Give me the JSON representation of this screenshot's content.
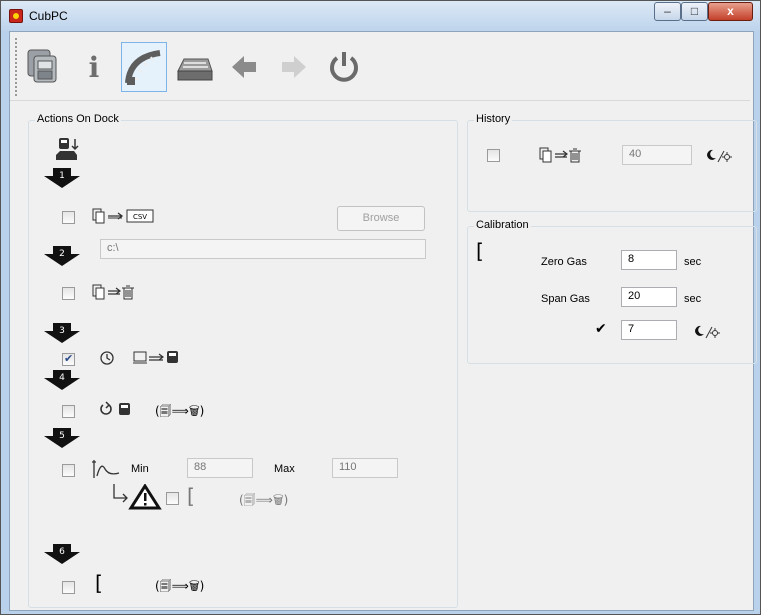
{
  "window": {
    "title": "CubPC",
    "minimize": "–",
    "maximize": "□",
    "close": "x"
  },
  "toolbar": {
    "icons": [
      "devices-icon",
      "info-icon",
      "gauge-icon",
      "printer-icon",
      "back-arrow-icon",
      "forward-arrow-icon",
      "power-icon"
    ],
    "info_glyph": "i"
  },
  "actions_on_dock": {
    "label": "Actions On Dock",
    "steps": [
      "1",
      "2",
      "3",
      "4",
      "5",
      "6"
    ],
    "browse_label": "Browse",
    "path_value": "c:\\",
    "csv_label": "CSV",
    "min_label": "Min",
    "min_value": "88",
    "max_label": "Max",
    "max_value": "110",
    "copy_then_delete": "(🗐⟹🗑)",
    "step3_checked": true
  },
  "history": {
    "label": "History",
    "value": "40"
  },
  "calibration": {
    "label": "Calibration",
    "zero_gas_label": "Zero Gas",
    "zero_gas_value": "8",
    "span_gas_label": "Span Gas",
    "span_gas_value": "20",
    "unit": "sec",
    "check_glyph": "✔",
    "interval_value": "7"
  }
}
